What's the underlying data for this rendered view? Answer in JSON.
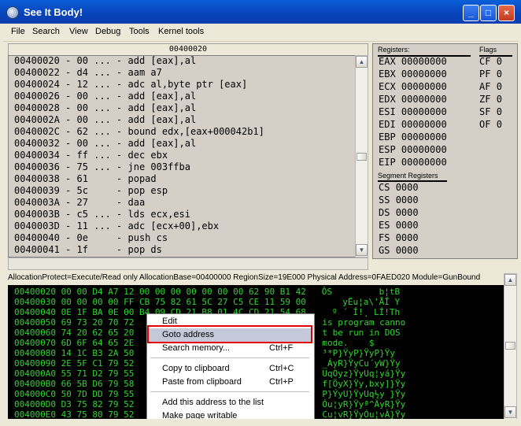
{
  "window": {
    "title": "See It Body!"
  },
  "menu": [
    "File",
    "Search",
    "View",
    "Debug",
    "Tools",
    "Kernel tools"
  ],
  "disasm": {
    "header": "00400020",
    "lines": [
      "00400020 - 00 ... - add [eax],al",
      "00400022 - d4 ... - aam a7",
      "00400024 - 12 ... - adc al,byte ptr [eax]",
      "00400026 - 00 ... - add [eax],al",
      "00400028 - 00 ... - add [eax],al",
      "0040002A - 00 ... - add [eax],al",
      "0040002C - 62 ... - bound edx,[eax+000042b1]",
      "00400032 - 00 ... - add [eax],al",
      "00400034 - ff ... - dec ebx",
      "00400036 - 75 ... - jne 003ffba",
      "00400038 - 61     - popad",
      "00400039 - 5c     - pop esp",
      "0040003A - 27     - daa",
      "0040003B - c5 ... - lds ecx,esi",
      "0040003D - 11 ... - adc [ecx+00],ebx",
      "00400040 - 0e     - push cs",
      "00400041 - 1f     - pop ds"
    ]
  },
  "registers": {
    "label": "Registers:",
    "flags_label": "Flags",
    "items": [
      {
        "name": "EAX",
        "value": "00000000"
      },
      {
        "name": "EBX",
        "value": "00000000"
      },
      {
        "name": "ECX",
        "value": "00000000"
      },
      {
        "name": "EDX",
        "value": "00000000"
      },
      {
        "name": "ESI",
        "value": "00000000"
      },
      {
        "name": "EDI",
        "value": "00000000"
      },
      {
        "name": "EBP",
        "value": "00000000"
      },
      {
        "name": "ESP",
        "value": "00000000"
      },
      {
        "name": "EIP",
        "value": "00000000"
      }
    ],
    "flags": [
      {
        "name": "CF",
        "value": "0"
      },
      {
        "name": "PF",
        "value": "0"
      },
      {
        "name": "AF",
        "value": "0"
      },
      {
        "name": "ZF",
        "value": "0"
      },
      {
        "name": "SF",
        "value": "0"
      },
      {
        "name": "OF",
        "value": "0"
      }
    ],
    "segment_label": "Segment Registers",
    "segments": [
      {
        "name": "CS",
        "value": "0000"
      },
      {
        "name": "SS",
        "value": "0000"
      },
      {
        "name": "DS",
        "value": "0000"
      },
      {
        "name": "ES",
        "value": "0000"
      },
      {
        "name": "FS",
        "value": "0000"
      },
      {
        "name": "GS",
        "value": "0000"
      }
    ]
  },
  "memory": {
    "info": "AllocationProtect=Execute/Read only  AllocationBase=00400000 RegionSize=19E000 Physical Address=0FAED020 Module=GunBound",
    "lines": [
      {
        "addr": "00400020",
        "hex": "00 00 D4 A7 12 00 00 00 00 00 00 00 62 90 B1 42",
        "ascii": "ÔS         b¦tB"
      },
      {
        "addr": "00400030",
        "hex": "00 00 00 00 FF CB 75 82 61 5C 27 C5 CE 11 59 00",
        "ascii": "    yËu¦a\\'ÅÎ Y"
      },
      {
        "addr": "00400040",
        "hex": "0E 1F BA 0E 00 B4 09 CD 21 B8 01 4C CD 21 54 68",
        "ascii": "  º ´ Í!¸ LÍ!Th"
      },
      {
        "addr": "00400050",
        "hex": "69 73 20 70 72",
        "ascii": "is program canno"
      },
      {
        "addr": "00400060",
        "hex": "74 20 62 65 20",
        "ascii": "t be run in DOS"
      },
      {
        "addr": "00400070",
        "hex": "6D 6F 64 65 2E",
        "ascii": "mode.    $"
      },
      {
        "addr": "00400080",
        "hex": "14 1C B3 2A 50",
        "ascii": "³*P}ŸyP}ŸyP}Ÿy"
      },
      {
        "addr": "00400090",
        "hex": "2E 5F C1 79 52",
        "ascii": "_ÁyR}ŸyCu´yW}Ÿy"
      },
      {
        "addr": "004000A0",
        "hex": "55 71 D2 79 55",
        "ascii": "UqÒyz}ŸyUq¦yá}Ÿy"
      },
      {
        "addr": "004000B0",
        "hex": "66 5B D6 79 58",
        "ascii": "f[ÖyX}Ÿy,bxy]}Ÿy"
      },
      {
        "addr": "004000C0",
        "hex": "50 7D DD 79 55",
        "ascii": "P}ÝyU}ŸyUq½y }Ÿy"
      },
      {
        "addr": "004000D0",
        "hex": "D3 75 82 79 52",
        "ascii": "Óu¦yR}Ÿyª^ÄyR}Ÿy"
      },
      {
        "addr": "004000E0",
        "hex": "43 75 80 79 52",
        "ascii": "Cu¦vR}ŸyÓu¦vÀ}Ÿy"
      }
    ]
  },
  "context_menu": {
    "items": [
      {
        "label": "Edit",
        "shortcut": ""
      },
      {
        "label": "Goto address",
        "shortcut": ""
      },
      {
        "label": "Search memory...",
        "shortcut": "Ctrl+F"
      },
      {
        "label": "Copy to clipboard",
        "shortcut": "Ctrl+C"
      },
      {
        "label": "Paste from clipboard",
        "shortcut": "Ctrl+P"
      },
      {
        "label": "Add this address to the list",
        "shortcut": ""
      },
      {
        "label": "Make page writable",
        "shortcut": ""
      }
    ]
  }
}
